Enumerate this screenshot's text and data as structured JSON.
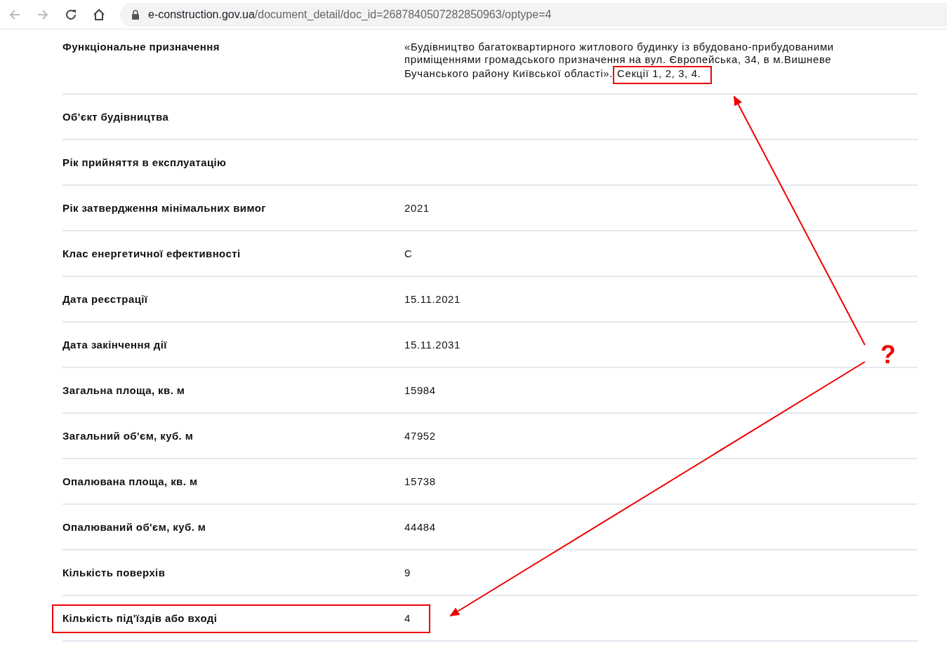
{
  "browser": {
    "url_host": "e-construction.gov.ua",
    "url_path": "/document_detail/doc_id=2687840507282850963/optype=4"
  },
  "rows": [
    {
      "label": "Функціональне призначення",
      "value": "«Будівництво багатоквартирного житлового будинку із вбудовано-прибудованими приміщеннями громадського призначення на вул. Європейська, 34, в м.Вишневе Бучанського району Київської області».",
      "value_highlight": "Секції 1, 2, 3, 4.",
      "highlighted": false
    },
    {
      "label": "Об'єкт будівництва",
      "highlighted": false
    },
    {
      "label": "Рік прийняття в експлуатацію",
      "highlighted": false
    },
    {
      "label": "Рік затвердження мінімальних вимог",
      "value": "2021",
      "highlighted": false
    },
    {
      "label": "Клас енергетичної ефективності",
      "value": "C",
      "highlighted": false
    },
    {
      "label": "Дата реєстрації",
      "value": "15.11.2021",
      "highlighted": false
    },
    {
      "label": "Дата закінчення дії",
      "value": "15.11.2031",
      "highlighted": false
    },
    {
      "label": "Загальна площа, кв. м",
      "value": "15984",
      "highlighted": false
    },
    {
      "label": "Загальний об'єм, куб. м",
      "value": "47952",
      "highlighted": false
    },
    {
      "label": "Опалювана площа, кв. м",
      "value": "15738",
      "highlighted": false
    },
    {
      "label": "Опалюваний об'єм, куб. м",
      "value": "44484",
      "highlighted": false
    },
    {
      "label": "Кількість поверхів",
      "value": "9",
      "highlighted": false
    },
    {
      "label": "Кількість під'їздів або вході",
      "value": "4",
      "highlighted": true
    }
  ],
  "annotation": {
    "mark": "?"
  }
}
